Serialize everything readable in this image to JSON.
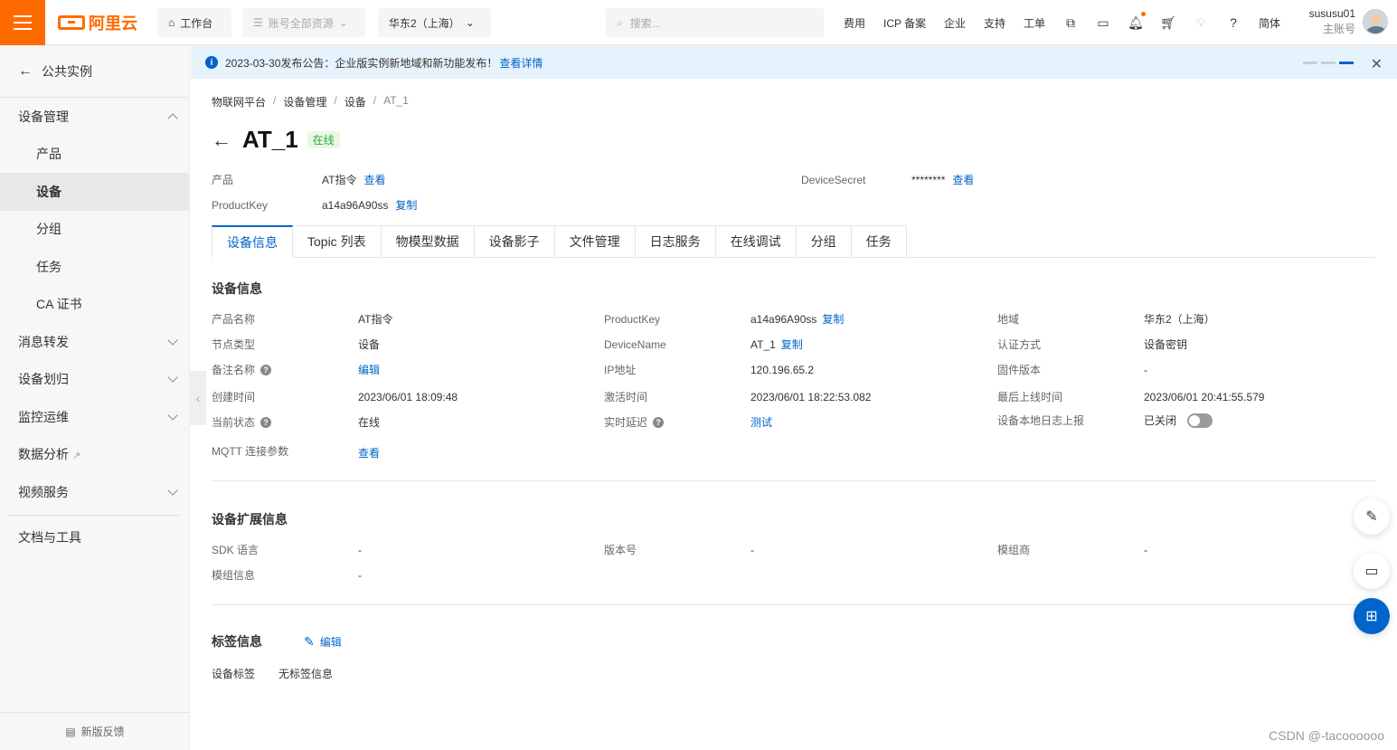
{
  "topbar": {
    "logo": "阿里云",
    "workbench": "工作台",
    "resources": "账号全部资源",
    "region": "华东2（上海）",
    "search_placeholder": "搜索...",
    "links": [
      "费用",
      "ICP 备案",
      "企业",
      "支持",
      "工单"
    ],
    "lang": "简体",
    "user_name": "sususu01",
    "user_role": "主账号"
  },
  "sidebar": {
    "back": "公共实例",
    "items": [
      {
        "label": "设备管理"
      },
      {
        "label": "产品"
      },
      {
        "label": "设备"
      },
      {
        "label": "分组"
      },
      {
        "label": "任务"
      },
      {
        "label": "CA 证书"
      },
      {
        "label": "消息转发"
      },
      {
        "label": "设备划归"
      },
      {
        "label": "监控运维"
      },
      {
        "label": "数据分析"
      },
      {
        "label": "视频服务"
      },
      {
        "label": "文档与工具"
      }
    ],
    "footer": "新版反馈"
  },
  "announcement": {
    "text": "2023-03-30发布公告：企业版实例新地域和新功能发布！",
    "link": "查看详情"
  },
  "breadcrumb": [
    "物联网平台",
    "设备管理",
    "设备",
    "AT_1"
  ],
  "device": {
    "name": "AT_1",
    "status": "在线",
    "product_label": "产品",
    "product_value": "AT指令",
    "product_link": "查看",
    "productkey_label": "ProductKey",
    "productkey_value": "a14a96A90ss",
    "copy": "复制",
    "secret_label": "DeviceSecret",
    "secret_value": "********",
    "secret_link": "查看"
  },
  "tabs": [
    "设备信息",
    "Topic 列表",
    "物模型数据",
    "设备影子",
    "文件管理",
    "日志服务",
    "在线调试",
    "分组",
    "任务"
  ],
  "info": {
    "title": "设备信息",
    "col1": [
      {
        "label": "产品名称",
        "value": "AT指令"
      },
      {
        "label": "节点类型",
        "value": "设备"
      },
      {
        "label": "备注名称",
        "value": "编辑"
      },
      {
        "label": "创建时间",
        "value": "2023/06/01 18:09:48"
      },
      {
        "label": "当前状态",
        "value": "在线"
      },
      {
        "label": "MQTT 连接参数",
        "value": "查看"
      }
    ],
    "col2": [
      {
        "label": "ProductKey",
        "value": "a14a96A90ss",
        "link": "复制"
      },
      {
        "label": "DeviceName",
        "value": "AT_1",
        "link": "复制"
      },
      {
        "label": "IP地址",
        "value": "120.196.65.2"
      },
      {
        "label": "激活时间",
        "value": "2023/06/01 18:22:53.082"
      },
      {
        "label": "实时延迟",
        "value": "测试"
      }
    ],
    "col3": [
      {
        "label": "地域",
        "value": "华东2（上海）"
      },
      {
        "label": "认证方式",
        "value": "设备密钥"
      },
      {
        "label": "固件版本",
        "value": "-"
      },
      {
        "label": "最后上线时间",
        "value": "2023/06/01 20:41:55.579"
      },
      {
        "label": "设备本地日志上报",
        "value": "已关闭"
      }
    ]
  },
  "ext": {
    "title": "设备扩展信息",
    "sdk_label": "SDK 语言",
    "sdk_value": "-",
    "version_label": "版本号",
    "version_value": "-",
    "vendor_label": "模组商",
    "vendor_value": "-",
    "module_label": "模组信息",
    "module_value": "-"
  },
  "tags": {
    "title": "标签信息",
    "edit": "编辑",
    "label": "设备标签",
    "value": "无标签信息"
  },
  "watermark": "CSDN @-tacoooooo"
}
